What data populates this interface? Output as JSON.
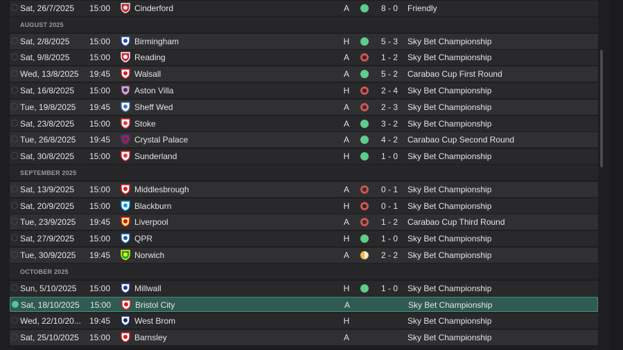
{
  "months": [
    {
      "label": "AUGUST 2025"
    },
    {
      "label": "SEPTEMBER 2025"
    },
    {
      "label": "OCTOBER 2025"
    }
  ],
  "fixtures": [
    {
      "date": "Sat, 26/7/2025",
      "time": "15:00",
      "opponent": "Cinderford",
      "crest": "cinderford-crest-icon",
      "crest_colors": [
        "#e8e8e8",
        "#c8262b"
      ],
      "venue": "A",
      "result": "W",
      "score": "8 - 0",
      "competition": "Friendly"
    },
    {
      "date": "Sat, 2/8/2025",
      "time": "15:00",
      "opponent": "Birmingham",
      "crest": "birmingham-crest-icon",
      "crest_colors": [
        "#2a4fa0",
        "#ffffff"
      ],
      "venue": "H",
      "result": "W",
      "score": "5 - 3",
      "competition": "Sky Bet Championship"
    },
    {
      "date": "Sat, 9/8/2025",
      "time": "15:00",
      "opponent": "Reading",
      "crest": "reading-crest-icon",
      "crest_colors": [
        "#ffffff",
        "#d0243c"
      ],
      "venue": "A",
      "result": "L",
      "score": "1 - 2",
      "competition": "Sky Bet Championship"
    },
    {
      "date": "Wed, 13/8/2025",
      "time": "19:45",
      "opponent": "Walsall",
      "crest": "walsall-crest-icon",
      "crest_colors": [
        "#d3202e",
        "#ffffff"
      ],
      "venue": "A",
      "result": "W",
      "score": "5 - 2",
      "competition": "Carabao Cup First Round"
    },
    {
      "date": "Sat, 16/8/2025",
      "time": "15:00",
      "opponent": "Aston Villa",
      "crest": "aston-villa-crest-icon",
      "crest_colors": [
        "#7a1f3d",
        "#9cc3e5"
      ],
      "venue": "H",
      "result": "L",
      "score": "2 - 4",
      "competition": "Sky Bet Championship"
    },
    {
      "date": "Tue, 19/8/2025",
      "time": "19:45",
      "opponent": "Sheff Wed",
      "crest": "sheff-wed-crest-icon",
      "crest_colors": [
        "#4a78c0",
        "#ffffff"
      ],
      "venue": "A",
      "result": "L",
      "score": "2 - 3",
      "competition": "Sky Bet Championship"
    },
    {
      "date": "Sat, 23/8/2025",
      "time": "15:00",
      "opponent": "Stoke",
      "crest": "stoke-crest-icon",
      "crest_colors": [
        "#e03a3e",
        "#ffffff"
      ],
      "venue": "A",
      "result": "W",
      "score": "3 - 2",
      "competition": "Sky Bet Championship"
    },
    {
      "date": "Tue, 26/8/2025",
      "time": "19:45",
      "opponent": "Crystal Palace",
      "crest": "crystal-palace-crest-icon",
      "crest_colors": [
        "#1b458f",
        "#c4122e"
      ],
      "venue": "A",
      "result": "W",
      "score": "4 - 2",
      "competition": "Carabao Cup Second Round"
    },
    {
      "date": "Sat, 30/8/2025",
      "time": "15:00",
      "opponent": "Sunderland",
      "crest": "sunderland-crest-icon",
      "crest_colors": [
        "#e03a3e",
        "#ffffff"
      ],
      "venue": "H",
      "result": "W",
      "score": "1 - 0",
      "competition": "Sky Bet Championship"
    },
    {
      "date": "Sat, 13/9/2025",
      "time": "15:00",
      "opponent": "Middlesbrough",
      "crest": "middlesbrough-crest-icon",
      "crest_colors": [
        "#e11b22",
        "#ffffff"
      ],
      "venue": "A",
      "result": "L",
      "score": "0 - 1",
      "competition": "Sky Bet Championship"
    },
    {
      "date": "Sat, 20/9/2025",
      "time": "15:00",
      "opponent": "Blackburn",
      "crest": "blackburn-crest-icon",
      "crest_colors": [
        "#009ee0",
        "#ffffff"
      ],
      "venue": "H",
      "result": "L",
      "score": "0 - 1",
      "competition": "Sky Bet Championship"
    },
    {
      "date": "Tue, 23/9/2025",
      "time": "19:45",
      "opponent": "Liverpool",
      "crest": "liverpool-crest-icon",
      "crest_colors": [
        "#c8102e",
        "#f6eb61"
      ],
      "venue": "A",
      "result": "L",
      "score": "1 - 2",
      "competition": "Carabao Cup Third Round"
    },
    {
      "date": "Sat, 27/9/2025",
      "time": "15:00",
      "opponent": "QPR",
      "crest": "qpr-crest-icon",
      "crest_colors": [
        "#1d5ba4",
        "#ffffff"
      ],
      "venue": "H",
      "result": "W",
      "score": "1 - 0",
      "competition": "Sky Bet Championship"
    },
    {
      "date": "Tue, 30/9/2025",
      "time": "19:45",
      "opponent": "Norwich",
      "crest": "norwich-crest-icon",
      "crest_colors": [
        "#fff200",
        "#00a650"
      ],
      "venue": "A",
      "result": "D",
      "score": "2 - 2",
      "competition": "Sky Bet Championship"
    },
    {
      "date": "Sun, 5/10/2025",
      "time": "15:00",
      "opponent": "Millwall",
      "crest": "millwall-crest-icon",
      "crest_colors": [
        "#1f3c88",
        "#ffffff"
      ],
      "venue": "H",
      "result": "W",
      "score": "1 - 0",
      "competition": "Sky Bet Championship"
    },
    {
      "date": "Sat, 18/10/2025",
      "time": "15:00",
      "opponent": "Bristol City",
      "crest": "bristol-city-crest-icon",
      "crest_colors": [
        "#e21a23",
        "#ffffff"
      ],
      "venue": "A",
      "result": "",
      "score": "",
      "competition": "Sky Bet Championship",
      "selected": true
    },
    {
      "date": "Wed, 22/10/20...",
      "time": "19:45",
      "opponent": "West Brom",
      "crest": "west-brom-crest-icon",
      "crest_colors": [
        "#122f67",
        "#ffffff"
      ],
      "venue": "H",
      "result": "",
      "score": "",
      "competition": "Sky Bet Championship"
    },
    {
      "date": "Sat, 25/10/2025",
      "time": "15:00",
      "opponent": "Barnsley",
      "crest": "barnsley-crest-icon",
      "crest_colors": [
        "#d71920",
        "#ffffff"
      ],
      "venue": "A",
      "result": "",
      "score": "",
      "competition": "Sky Bet Championship"
    }
  ]
}
